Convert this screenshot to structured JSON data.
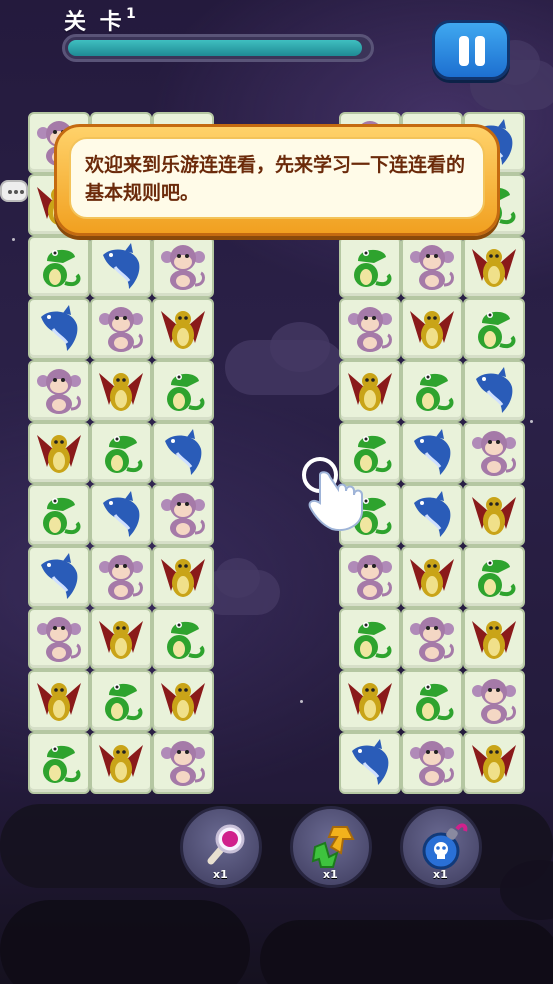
{
  "header": {
    "level_label": "关 卡",
    "level_number": "1",
    "progress_fraction": 0.98
  },
  "tutorial": {
    "message": "欢迎来到乐游连连看，先来学习一下连连看的基本规则吧。"
  },
  "board_left": [
    [
      "monkey",
      "dragon",
      "croc"
    ],
    [
      "dragon",
      "dragon",
      "monkey"
    ],
    [
      "croc",
      "dolphin",
      "monkey"
    ],
    [
      "dolphin",
      "monkey",
      "dragon"
    ],
    [
      "monkey",
      "dragon",
      "croc"
    ],
    [
      "dragon",
      "croc",
      "dolphin"
    ],
    [
      "croc",
      "dolphin",
      "monkey"
    ],
    [
      "dolphin",
      "monkey",
      "dragon"
    ],
    [
      "monkey",
      "dragon",
      "croc"
    ],
    [
      "dragon",
      "croc",
      "dragon"
    ],
    [
      "croc",
      "dragon",
      "monkey"
    ]
  ],
  "board_right": [
    [
      "monkey",
      "croc",
      "dolphin"
    ],
    [
      "dragon",
      "monkey",
      "croc"
    ],
    [
      "croc",
      "monkey",
      "dragon"
    ],
    [
      "monkey",
      "dragon",
      "croc"
    ],
    [
      "dragon",
      "croc",
      "dolphin"
    ],
    [
      "croc",
      "dolphin",
      "monkey"
    ],
    [
      "croc",
      "dolphin",
      "dragon"
    ],
    [
      "monkey",
      "dragon",
      "croc"
    ],
    [
      "croc",
      "monkey",
      "dragon"
    ],
    [
      "dragon",
      "croc",
      "monkey"
    ],
    [
      "dolphin",
      "monkey",
      "dragon"
    ]
  ],
  "tools": [
    {
      "name": "magnifier-hint",
      "icon": "magnifier-icon",
      "count": "x1"
    },
    {
      "name": "shuffle",
      "icon": "shuffle-arrows-icon",
      "count": "x1"
    },
    {
      "name": "bomb",
      "icon": "bomb-icon",
      "count": "x1"
    }
  ],
  "colors": {
    "progress": "#2aa3ab",
    "pause_button": "#2a8ae0",
    "tooltip_border": "#f1a020",
    "tooltip_text": "#6b2a0a"
  }
}
